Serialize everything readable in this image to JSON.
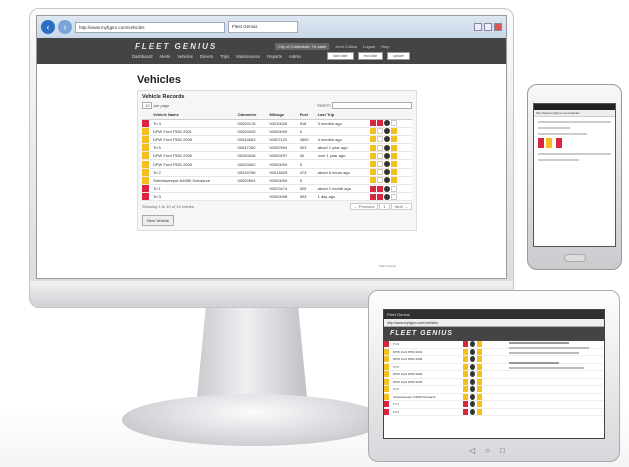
{
  "browser": {
    "url": "http://www.myfgpro.com/vehicles",
    "tab_title": "Fleet Genius"
  },
  "app": {
    "logo": "FLEET GENIUS",
    "city": "City of Cottesdale, Tri-state",
    "user": "John Collins",
    "logout": "Logout",
    "help": "Help",
    "menu": [
      "Dashboard",
      "Alerts",
      "Vehicles",
      "Drivers",
      "Trips",
      "Maintenance",
      "Reports",
      "Admin"
    ],
    "start_date": "start date",
    "end_date": "end date",
    "update": "update"
  },
  "page": {
    "title": "Vehicles",
    "panel_title": "Vehicle Records",
    "per_page": "10",
    "per_page_label": "per page",
    "search_label": "Search:"
  },
  "table": {
    "headers": [
      "",
      "Vehicle Name",
      "Odometer",
      "Mileage",
      "Fuel",
      "Last Trip",
      ""
    ],
    "rows": [
      {
        "status": "red",
        "name": "Tri 4",
        "odometer": "00000176",
        "mileage": "00010026",
        "fuel": "918",
        "last": "3 months ago"
      },
      {
        "status": "yellow",
        "name": "DPW Ford F550 2001",
        "odometer": "00000025",
        "mileage": "00000000",
        "fuel": "0",
        "last": ""
      },
      {
        "status": "yellow",
        "name": "DPW Ford F550 2008",
        "odometer": "00044653",
        "mileage": "00007122",
        "fuel": "2800",
        "last": "4 months ago"
      },
      {
        "status": "yellow",
        "name": "Tri 5",
        "odometer": "00047250",
        "mileage": "00002994",
        "fuel": "303",
        "last": "about 1 year ago"
      },
      {
        "status": "yellow",
        "name": "DPW Ford F550 2006",
        "odometer": "00040548",
        "mileage": "00000297",
        "fuel": "40",
        "last": "over 1 year ago"
      },
      {
        "status": "yellow",
        "name": "DPW Ford F550 2005",
        "odometer": "00020002",
        "mileage": "00000000",
        "fuel": "0",
        "last": ""
      },
      {
        "status": "yellow",
        "name": "Tri 2",
        "odometer": "00018766",
        "mileage": "00014829",
        "fuel": "473",
        "last": "about 6 hours ago"
      },
      {
        "status": "yellow",
        "name": "Streetsweeper A4050 Schwarze",
        "odometer": "00000504",
        "mileage": "00000000",
        "fuel": "0",
        "last": ""
      },
      {
        "status": "red",
        "name": "Tri 1",
        "odometer": "",
        "mileage": "00023474",
        "fuel": "925",
        "last": "about 1 month ago"
      },
      {
        "status": "red",
        "name": "Tri 3",
        "odometer": "",
        "mileage": "00000098",
        "fuel": "593",
        "last": "1 day ago"
      }
    ]
  },
  "footer": {
    "showing": "Showing 1 to 10 of 10 entries",
    "previous": "← Previous",
    "page": "1",
    "next": "Next →",
    "new_vehicle": "New Vehicle",
    "copyright": "Fleet Genius"
  },
  "colors": {
    "red": "#d7263d",
    "yellow": "#f4c020",
    "header": "#444444"
  }
}
